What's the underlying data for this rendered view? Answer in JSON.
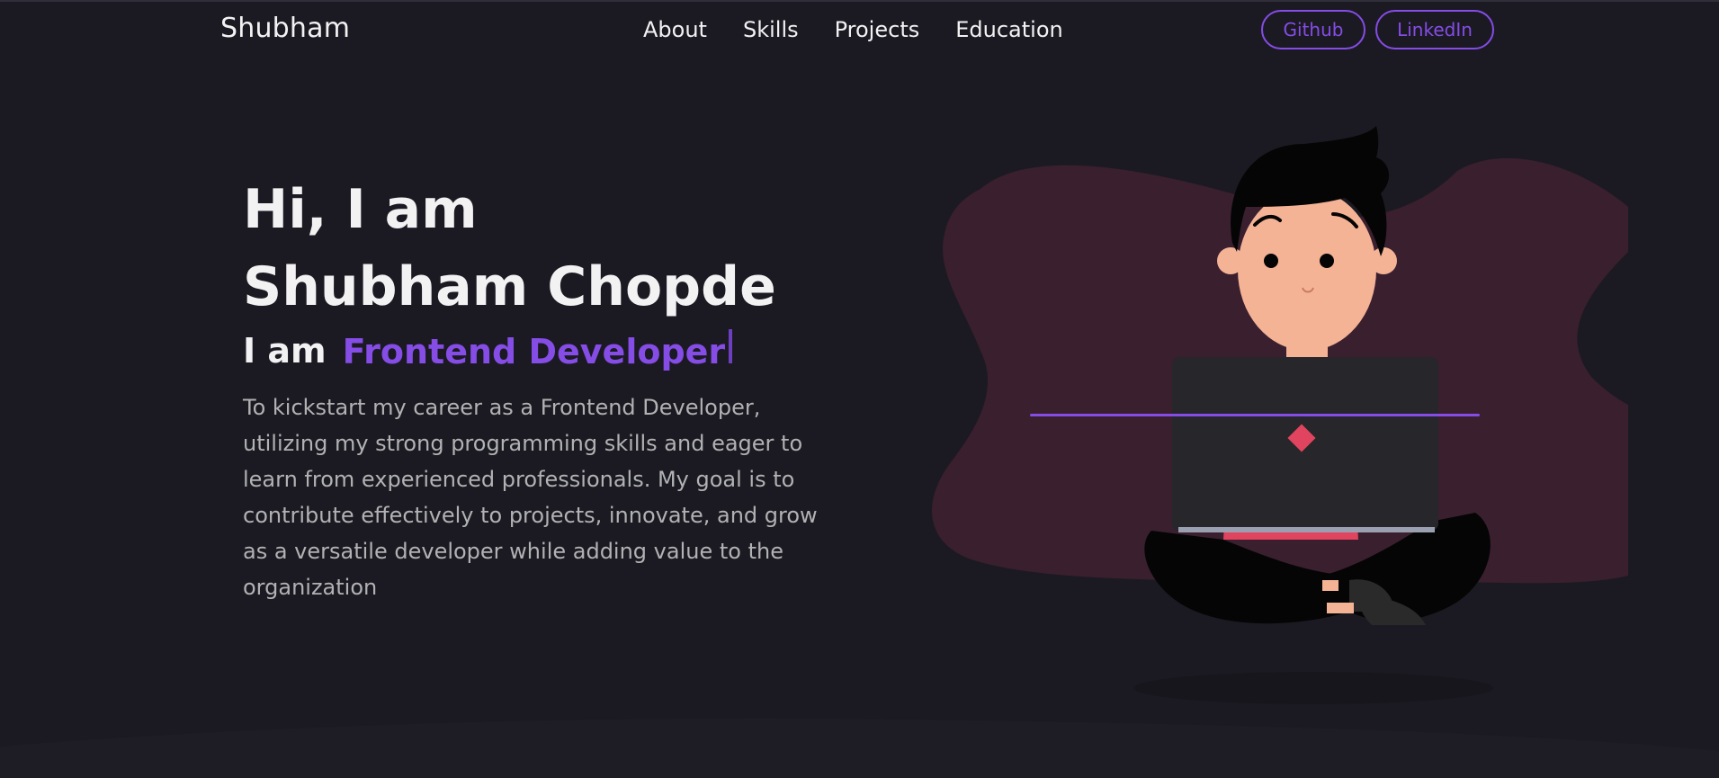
{
  "header": {
    "brand": "Shubham",
    "nav": [
      "About",
      "Skills",
      "Projects",
      "Education"
    ],
    "buttons": {
      "github": "Github",
      "linkedin": "LinkedIn"
    }
  },
  "hero": {
    "greeting": "Hi, I am",
    "name": "Shubham Chopde",
    "role_prefix": "I am",
    "role_typed": "Frontend Developer",
    "description": "To kickstart my career as a Frontend Developer, utilizing my strong programming skills and eager to learn from experienced professionals. My goal is to contribute effectively to projects, innovate, and grow as a versatile developer while adding value to the organization"
  },
  "colors": {
    "background": "#1b1a22",
    "accent": "#854ce6",
    "text_primary": "#f2f2f3",
    "text_secondary": "#b1b2b3",
    "blob": "#3a1f2e"
  },
  "illustration": {
    "name": "developer-with-laptop-illustration"
  }
}
